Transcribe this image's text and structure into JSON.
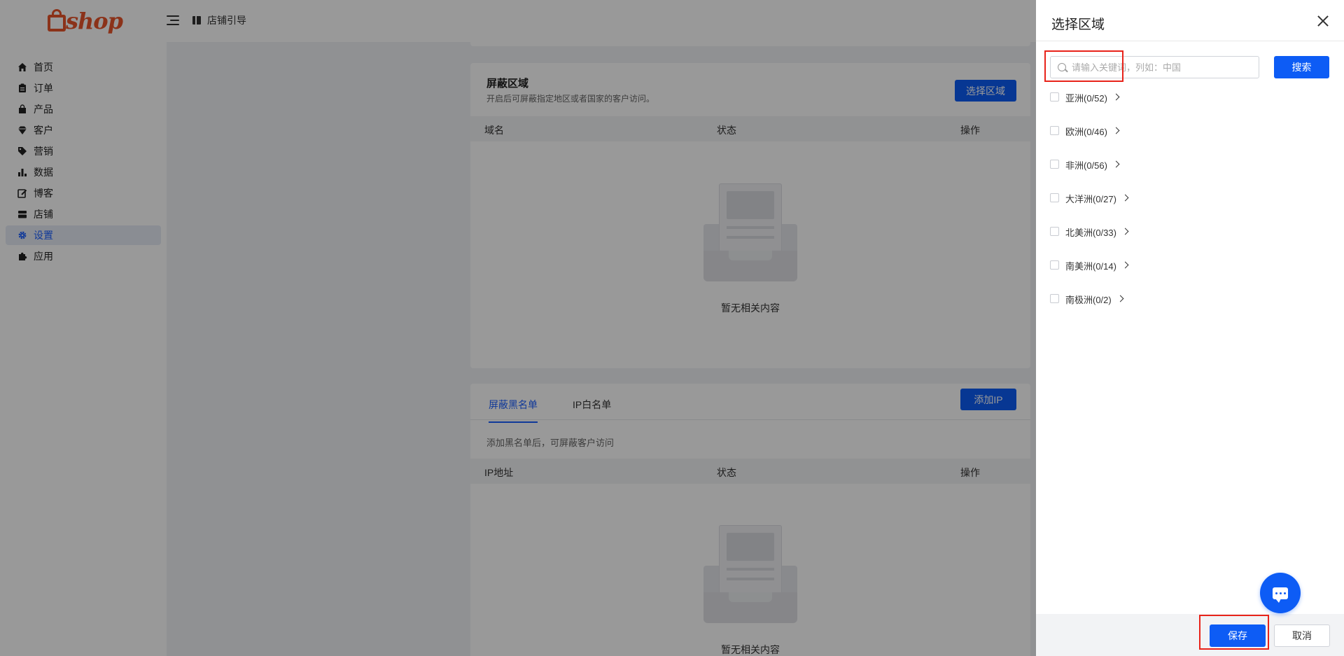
{
  "header": {
    "logo_text": "shop",
    "guide_label": "店铺引导"
  },
  "sidebar": {
    "items": [
      {
        "label": "首页",
        "icon": "home-icon"
      },
      {
        "label": "订单",
        "icon": "order-icon"
      },
      {
        "label": "产品",
        "icon": "product-icon"
      },
      {
        "label": "客户",
        "icon": "customer-icon"
      },
      {
        "label": "营销",
        "icon": "tag-icon"
      },
      {
        "label": "数据",
        "icon": "bar-chart-icon"
      },
      {
        "label": "博客",
        "icon": "blog-icon"
      },
      {
        "label": "店铺",
        "icon": "store-icon"
      },
      {
        "label": "设置",
        "icon": "gear-icon",
        "active": true
      },
      {
        "label": "应用",
        "icon": "puzzle-icon"
      }
    ]
  },
  "region_block": {
    "title": "屏蔽区域",
    "subtitle": "开启后可屏蔽指定地区或者国家的客户访问。",
    "select_button": "选择区域",
    "columns": [
      "域名",
      "状态",
      "操作"
    ],
    "empty_text": "暂无相关内容"
  },
  "blacklist": {
    "tabs": [
      "屏蔽黑名单",
      "IP白名单"
    ],
    "add_button": "添加IP",
    "hint": "添加黑名单后，可屏蔽客户访问",
    "columns": [
      "IP地址",
      "状态",
      "操作"
    ],
    "empty_text": "暂无相关内容"
  },
  "drawer": {
    "title": "选择区域",
    "search_placeholder": "请输入关键词，列如：中国",
    "search_button": "搜索",
    "regions": [
      "亚洲(0/52)",
      "欧洲(0/46)",
      "非洲(0/56)",
      "大洋洲(0/27)",
      "北美洲(0/33)",
      "南美洲(0/14)",
      "南极洲(0/2)"
    ],
    "save_button": "保存",
    "cancel_button": "取消"
  },
  "colors": {
    "primary": "#0d5cf5",
    "brand": "#e8542a",
    "highlight": "#e8231a"
  }
}
